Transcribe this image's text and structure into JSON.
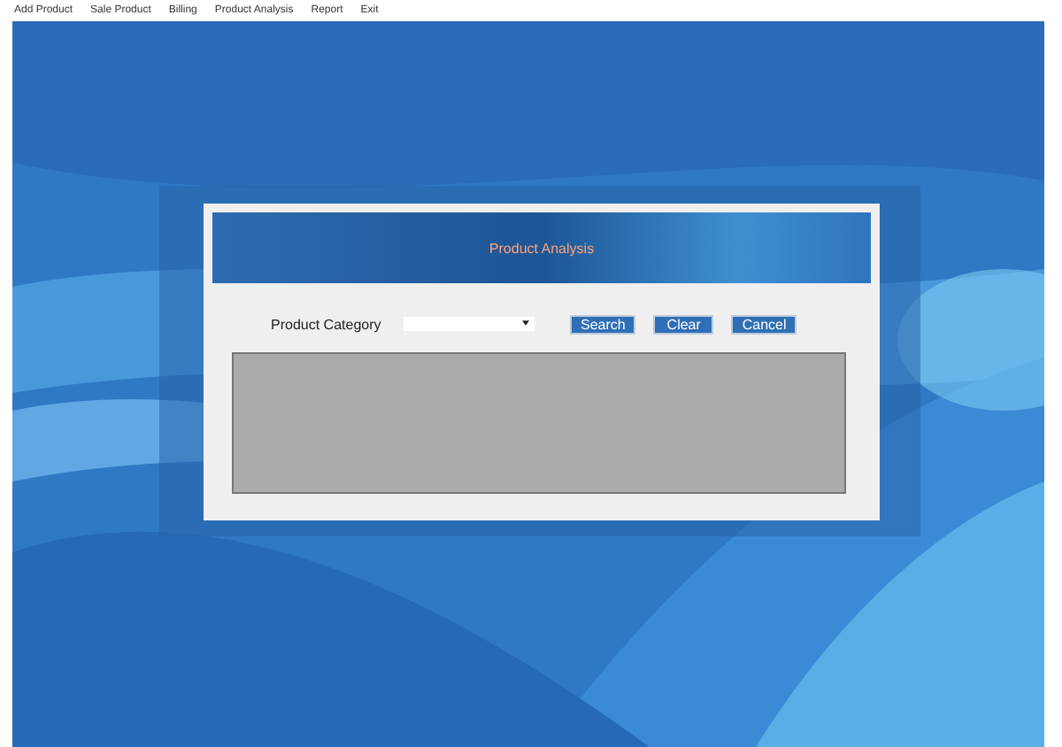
{
  "menu": [
    {
      "label": "Add Product"
    },
    {
      "label": "Sale Product"
    },
    {
      "label": "Billing"
    },
    {
      "label": "Product Analysis"
    },
    {
      "label": "Report"
    },
    {
      "label": "Exit"
    }
  ],
  "dialog": {
    "title": "Product Analysis",
    "category_label": "Product Category",
    "buttons": [
      {
        "label": "Search"
      },
      {
        "label": "Clear"
      },
      {
        "label": "Cancel"
      }
    ]
  }
}
